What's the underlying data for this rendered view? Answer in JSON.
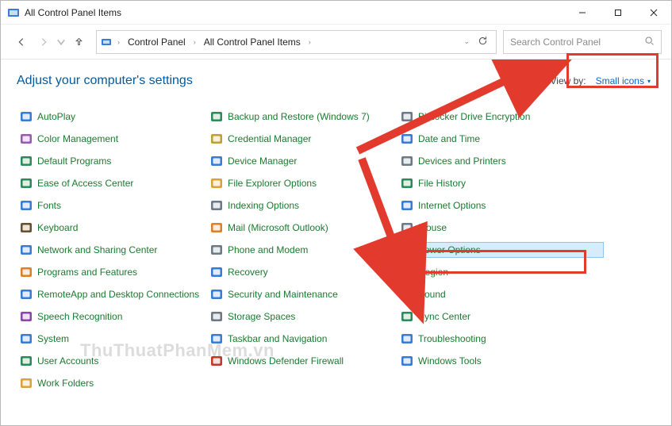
{
  "window": {
    "title": "All Control Panel Items"
  },
  "breadcrumb": {
    "seg1": "Control Panel",
    "seg2": "All Control Panel Items"
  },
  "search": {
    "placeholder": "Search Control Panel"
  },
  "heading": "Adjust your computer's settings",
  "viewby": {
    "label": "View by:",
    "value": "Small icons"
  },
  "items": {
    "col1": [
      {
        "label": "AutoPlay",
        "icon": "autoplay"
      },
      {
        "label": "Color Management",
        "icon": "color"
      },
      {
        "label": "Default Programs",
        "icon": "default-programs"
      },
      {
        "label": "Ease of Access Center",
        "icon": "ease-access"
      },
      {
        "label": "Fonts",
        "icon": "fonts"
      },
      {
        "label": "Keyboard",
        "icon": "keyboard"
      },
      {
        "label": "Network and Sharing Center",
        "icon": "network"
      },
      {
        "label": "Programs and Features",
        "icon": "programs"
      },
      {
        "label": "RemoteApp and Desktop Connections",
        "icon": "remoteapp"
      },
      {
        "label": "Speech Recognition",
        "icon": "speech"
      },
      {
        "label": "System",
        "icon": "system"
      },
      {
        "label": "User Accounts",
        "icon": "users"
      },
      {
        "label": "Work Folders",
        "icon": "work-folders"
      }
    ],
    "col2": [
      {
        "label": "Backup and Restore (Windows 7)",
        "icon": "backup"
      },
      {
        "label": "Credential Manager",
        "icon": "credential"
      },
      {
        "label": "Device Manager",
        "icon": "device-mgr"
      },
      {
        "label": "File Explorer Options",
        "icon": "file-explorer"
      },
      {
        "label": "Indexing Options",
        "icon": "indexing"
      },
      {
        "label": "Mail (Microsoft Outlook)",
        "icon": "mail"
      },
      {
        "label": "Phone and Modem",
        "icon": "phone"
      },
      {
        "label": "Recovery",
        "icon": "recovery"
      },
      {
        "label": "Security and Maintenance",
        "icon": "security"
      },
      {
        "label": "Storage Spaces",
        "icon": "storage"
      },
      {
        "label": "Taskbar and Navigation",
        "icon": "taskbar"
      },
      {
        "label": "Windows Defender Firewall",
        "icon": "firewall"
      }
    ],
    "col3": [
      {
        "label": "BitLocker Drive Encryption",
        "icon": "bitlocker"
      },
      {
        "label": "Date and Time",
        "icon": "datetime"
      },
      {
        "label": "Devices and Printers",
        "icon": "devices"
      },
      {
        "label": "File History",
        "icon": "file-history"
      },
      {
        "label": "Internet Options",
        "icon": "internet"
      },
      {
        "label": "Mouse",
        "icon": "mouse"
      },
      {
        "label": "Power Options",
        "icon": "power",
        "selected": true
      },
      {
        "label": "Region",
        "icon": "region"
      },
      {
        "label": "Sound",
        "icon": "sound"
      },
      {
        "label": "Sync Center",
        "icon": "sync"
      },
      {
        "label": "Troubleshooting",
        "icon": "troubleshoot"
      },
      {
        "label": "Windows Tools",
        "icon": "tools"
      }
    ]
  },
  "watermark": "ThuThuatPhanMem.vn"
}
